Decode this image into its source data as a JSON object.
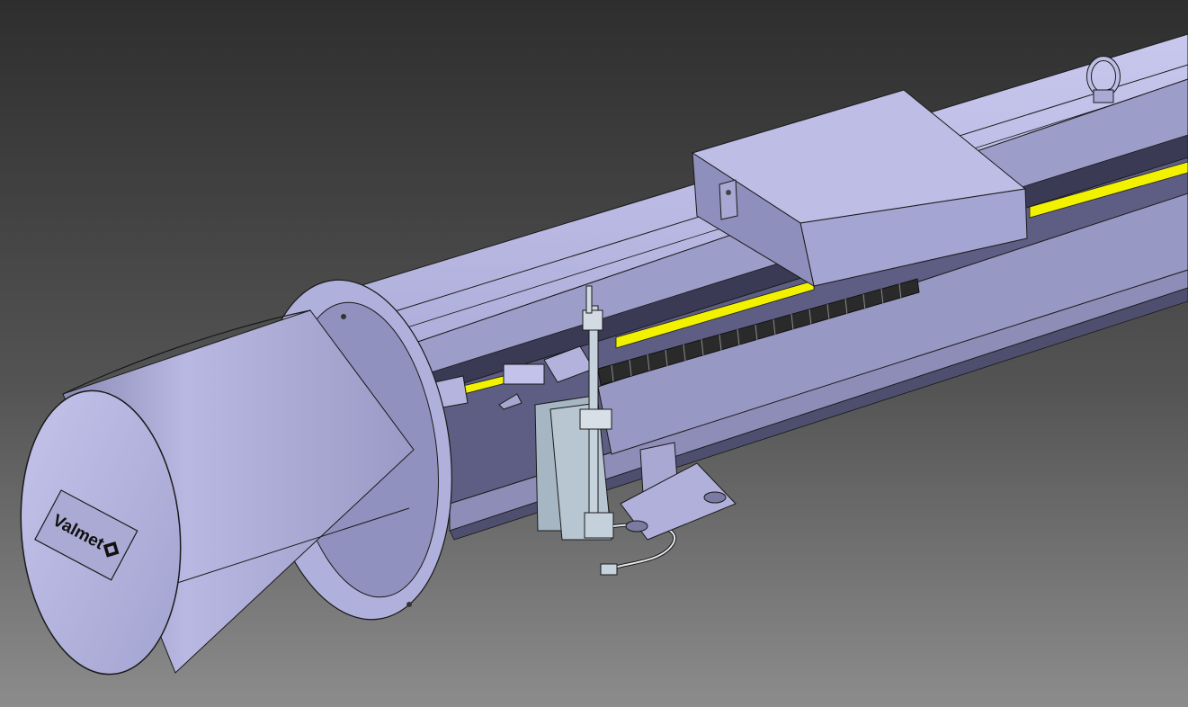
{
  "scene": {
    "background_top": "#2e2e2e",
    "background_bottom": "#8a8a8a",
    "body_color": "#b9b9e3",
    "body_shadow": "#9c9cc8",
    "body_dark": "#6d6d96",
    "accent_yellow": "#f2f200",
    "chain_color": "#2a2a2a",
    "bracket_color": "#a7b6c3",
    "edge_color": "#1a1a1a"
  },
  "logo": {
    "text": "Valmet",
    "icon": "valmet-diamond-icon"
  }
}
